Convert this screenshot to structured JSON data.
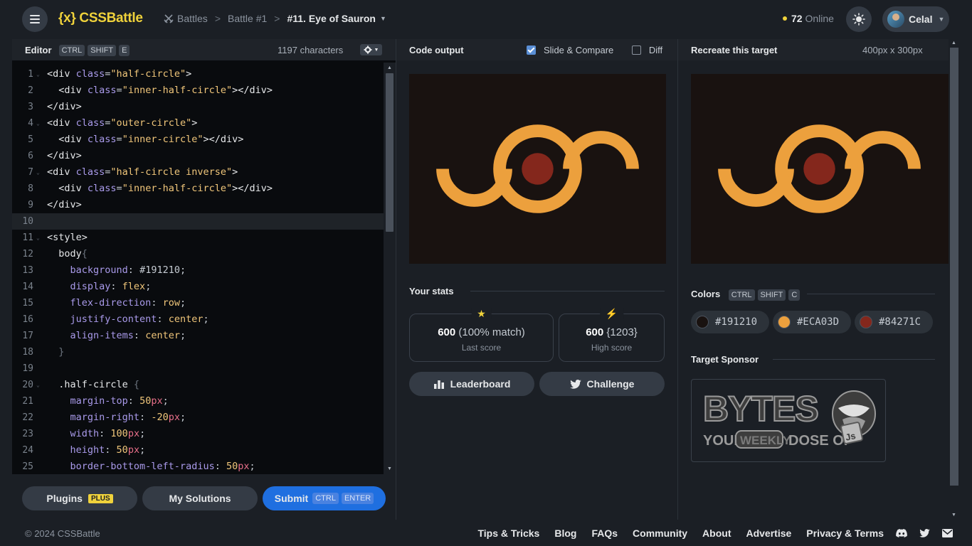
{
  "header": {
    "logo": "{x} CSSBattle",
    "breadcrumb": {
      "battles": "Battles",
      "battle": "Battle #1",
      "current": "#11. Eye of Sauron"
    },
    "online_count": "72",
    "online_label": "Online",
    "user_name": "Celal"
  },
  "editor": {
    "title": "Editor",
    "shortcut": [
      "CTRL",
      "SHIFT",
      "E"
    ],
    "char_count": "1197 characters",
    "lines": [
      "<div class=\"half-circle\">",
      "  <div class=\"inner-half-circle\"></div>",
      "</div>",
      "<div class=\"outer-circle\">",
      "  <div class=\"inner-circle\"></div>",
      "</div>",
      "<div class=\"half-circle inverse\">",
      "  <div class=\"inner-half-circle\"></div>",
      "</div>",
      "",
      "<style>",
      "  body{",
      "    background: #191210;",
      "    display: flex;",
      "    flex-direction: row;",
      "    justify-content: center;",
      "    align-items: center;",
      "  }",
      "",
      "  .half-circle {",
      "    margin-top: 50px;",
      "    margin-right: -20px;",
      "    width: 100px;",
      "    height: 50px;",
      "    border-bottom-left-radius: 50px;"
    ],
    "active_line": 10
  },
  "actions": {
    "plugins": "Plugins",
    "plugins_badge": "PLUS",
    "my_solutions": "My Solutions",
    "submit": "Submit",
    "submit_keys": [
      "CTRL",
      "ENTER"
    ]
  },
  "output": {
    "title": "Code output",
    "slide_compare": "Slide & Compare",
    "slide_compare_checked": true,
    "diff": "Diff",
    "diff_checked": false
  },
  "stats": {
    "title": "Your stats",
    "last_score": "600",
    "last_match": "(100% match)",
    "last_label": "Last score",
    "high_score": "600",
    "high_detail": "{1203}",
    "high_label": "High score",
    "leaderboard": "Leaderboard",
    "challenge": "Challenge"
  },
  "target": {
    "title": "Recreate this target",
    "size": "400px x 300px",
    "colors_title": "Colors",
    "colors_shortcut": [
      "CTRL",
      "SHIFT",
      "C"
    ],
    "colors": [
      "#191210",
      "#ECA03D",
      "#84271C"
    ],
    "sponsor_title": "Target Sponsor",
    "sponsor_logo_text": "BYTES YOUR WEEKLY DOSE OF JS"
  },
  "footer": {
    "copyright": "© 2024 CSSBattle",
    "links": [
      "Tips & Tricks",
      "Blog",
      "FAQs",
      "Community",
      "About",
      "Advertise",
      "Privacy & Terms"
    ]
  },
  "icons": {
    "menu": "menu-icon",
    "theme": "sun-icon",
    "battles": "swords-icon",
    "gear": "gear-icon",
    "star": "star-icon",
    "bolt": "bolt-icon",
    "leaderboard": "bar-chart-icon",
    "challenge": "twitter-icon",
    "discord": "discord-icon",
    "twitter": "twitter-icon",
    "mail": "mail-icon"
  }
}
